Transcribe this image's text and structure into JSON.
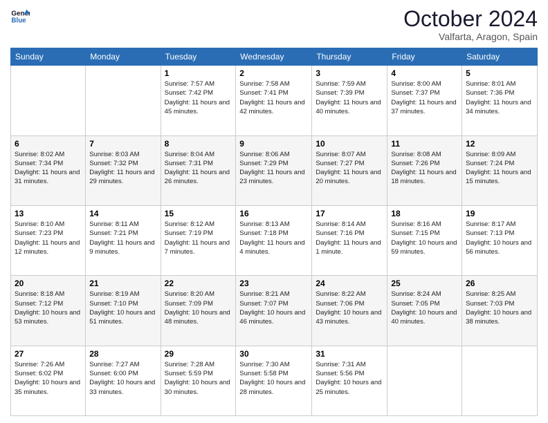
{
  "header": {
    "logo_general": "General",
    "logo_blue": "Blue",
    "month_title": "October 2024",
    "location": "Valfarta, Aragon, Spain"
  },
  "weekdays": [
    "Sunday",
    "Monday",
    "Tuesday",
    "Wednesday",
    "Thursday",
    "Friday",
    "Saturday"
  ],
  "weeks": [
    [
      {
        "num": "",
        "sunrise": "",
        "sunset": "",
        "daylight": ""
      },
      {
        "num": "",
        "sunrise": "",
        "sunset": "",
        "daylight": ""
      },
      {
        "num": "1",
        "sunrise": "Sunrise: 7:57 AM",
        "sunset": "Sunset: 7:42 PM",
        "daylight": "Daylight: 11 hours and 45 minutes."
      },
      {
        "num": "2",
        "sunrise": "Sunrise: 7:58 AM",
        "sunset": "Sunset: 7:41 PM",
        "daylight": "Daylight: 11 hours and 42 minutes."
      },
      {
        "num": "3",
        "sunrise": "Sunrise: 7:59 AM",
        "sunset": "Sunset: 7:39 PM",
        "daylight": "Daylight: 11 hours and 40 minutes."
      },
      {
        "num": "4",
        "sunrise": "Sunrise: 8:00 AM",
        "sunset": "Sunset: 7:37 PM",
        "daylight": "Daylight: 11 hours and 37 minutes."
      },
      {
        "num": "5",
        "sunrise": "Sunrise: 8:01 AM",
        "sunset": "Sunset: 7:36 PM",
        "daylight": "Daylight: 11 hours and 34 minutes."
      }
    ],
    [
      {
        "num": "6",
        "sunrise": "Sunrise: 8:02 AM",
        "sunset": "Sunset: 7:34 PM",
        "daylight": "Daylight: 11 hours and 31 minutes."
      },
      {
        "num": "7",
        "sunrise": "Sunrise: 8:03 AM",
        "sunset": "Sunset: 7:32 PM",
        "daylight": "Daylight: 11 hours and 29 minutes."
      },
      {
        "num": "8",
        "sunrise": "Sunrise: 8:04 AM",
        "sunset": "Sunset: 7:31 PM",
        "daylight": "Daylight: 11 hours and 26 minutes."
      },
      {
        "num": "9",
        "sunrise": "Sunrise: 8:06 AM",
        "sunset": "Sunset: 7:29 PM",
        "daylight": "Daylight: 11 hours and 23 minutes."
      },
      {
        "num": "10",
        "sunrise": "Sunrise: 8:07 AM",
        "sunset": "Sunset: 7:27 PM",
        "daylight": "Daylight: 11 hours and 20 minutes."
      },
      {
        "num": "11",
        "sunrise": "Sunrise: 8:08 AM",
        "sunset": "Sunset: 7:26 PM",
        "daylight": "Daylight: 11 hours and 18 minutes."
      },
      {
        "num": "12",
        "sunrise": "Sunrise: 8:09 AM",
        "sunset": "Sunset: 7:24 PM",
        "daylight": "Daylight: 11 hours and 15 minutes."
      }
    ],
    [
      {
        "num": "13",
        "sunrise": "Sunrise: 8:10 AM",
        "sunset": "Sunset: 7:23 PM",
        "daylight": "Daylight: 11 hours and 12 minutes."
      },
      {
        "num": "14",
        "sunrise": "Sunrise: 8:11 AM",
        "sunset": "Sunset: 7:21 PM",
        "daylight": "Daylight: 11 hours and 9 minutes."
      },
      {
        "num": "15",
        "sunrise": "Sunrise: 8:12 AM",
        "sunset": "Sunset: 7:19 PM",
        "daylight": "Daylight: 11 hours and 7 minutes."
      },
      {
        "num": "16",
        "sunrise": "Sunrise: 8:13 AM",
        "sunset": "Sunset: 7:18 PM",
        "daylight": "Daylight: 11 hours and 4 minutes."
      },
      {
        "num": "17",
        "sunrise": "Sunrise: 8:14 AM",
        "sunset": "Sunset: 7:16 PM",
        "daylight": "Daylight: 11 hours and 1 minute."
      },
      {
        "num": "18",
        "sunrise": "Sunrise: 8:16 AM",
        "sunset": "Sunset: 7:15 PM",
        "daylight": "Daylight: 10 hours and 59 minutes."
      },
      {
        "num": "19",
        "sunrise": "Sunrise: 8:17 AM",
        "sunset": "Sunset: 7:13 PM",
        "daylight": "Daylight: 10 hours and 56 minutes."
      }
    ],
    [
      {
        "num": "20",
        "sunrise": "Sunrise: 8:18 AM",
        "sunset": "Sunset: 7:12 PM",
        "daylight": "Daylight: 10 hours and 53 minutes."
      },
      {
        "num": "21",
        "sunrise": "Sunrise: 8:19 AM",
        "sunset": "Sunset: 7:10 PM",
        "daylight": "Daylight: 10 hours and 51 minutes."
      },
      {
        "num": "22",
        "sunrise": "Sunrise: 8:20 AM",
        "sunset": "Sunset: 7:09 PM",
        "daylight": "Daylight: 10 hours and 48 minutes."
      },
      {
        "num": "23",
        "sunrise": "Sunrise: 8:21 AM",
        "sunset": "Sunset: 7:07 PM",
        "daylight": "Daylight: 10 hours and 46 minutes."
      },
      {
        "num": "24",
        "sunrise": "Sunrise: 8:22 AM",
        "sunset": "Sunset: 7:06 PM",
        "daylight": "Daylight: 10 hours and 43 minutes."
      },
      {
        "num": "25",
        "sunrise": "Sunrise: 8:24 AM",
        "sunset": "Sunset: 7:05 PM",
        "daylight": "Daylight: 10 hours and 40 minutes."
      },
      {
        "num": "26",
        "sunrise": "Sunrise: 8:25 AM",
        "sunset": "Sunset: 7:03 PM",
        "daylight": "Daylight: 10 hours and 38 minutes."
      }
    ],
    [
      {
        "num": "27",
        "sunrise": "Sunrise: 7:26 AM",
        "sunset": "Sunset: 6:02 PM",
        "daylight": "Daylight: 10 hours and 35 minutes."
      },
      {
        "num": "28",
        "sunrise": "Sunrise: 7:27 AM",
        "sunset": "Sunset: 6:00 PM",
        "daylight": "Daylight: 10 hours and 33 minutes."
      },
      {
        "num": "29",
        "sunrise": "Sunrise: 7:28 AM",
        "sunset": "Sunset: 5:59 PM",
        "daylight": "Daylight: 10 hours and 30 minutes."
      },
      {
        "num": "30",
        "sunrise": "Sunrise: 7:30 AM",
        "sunset": "Sunset: 5:58 PM",
        "daylight": "Daylight: 10 hours and 28 minutes."
      },
      {
        "num": "31",
        "sunrise": "Sunrise: 7:31 AM",
        "sunset": "Sunset: 5:56 PM",
        "daylight": "Daylight: 10 hours and 25 minutes."
      },
      {
        "num": "",
        "sunrise": "",
        "sunset": "",
        "daylight": ""
      },
      {
        "num": "",
        "sunrise": "",
        "sunset": "",
        "daylight": ""
      }
    ]
  ]
}
